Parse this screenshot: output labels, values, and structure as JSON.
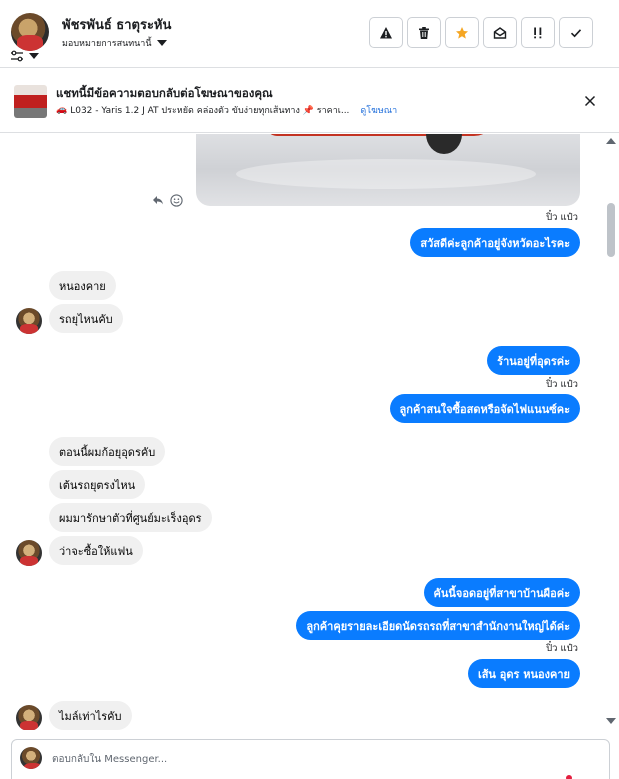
{
  "header": {
    "contact_name": "พัชรพันธ์ ธาตุระหัน",
    "assign_label": "มอบหมายการสนทนานี้",
    "actions": [
      {
        "name": "alert",
        "icon": "warning-icon"
      },
      {
        "name": "delete",
        "icon": "trash-icon"
      },
      {
        "name": "star",
        "icon": "star-icon"
      },
      {
        "name": "mark-unread",
        "icon": "envelope-open-icon"
      },
      {
        "name": "follow-up",
        "icon": "priority-icon"
      },
      {
        "name": "done",
        "icon": "check-icon"
      }
    ],
    "accent_star": "#f5a623"
  },
  "ad": {
    "title": "แชทนี้มีข้อความตอบกลับต่อโฆษณาของคุณ",
    "subtitle_prefix": "🚗",
    "subtitle": "L032 - Yaris 1.2 J AT ประหยัด คล่องตัว ขับง่ายทุกเส้นทาง 📌 ราคาเ...",
    "link": "ดูโฆษณา"
  },
  "messages": [
    {
      "id": "m1",
      "dir": "out",
      "text": "สวัสดีค่ะลูกค้าอยู่จังหวัดอะไรคะ",
      "seen": "ปิ๋ว แป๋ว"
    },
    {
      "id": "m2",
      "dir": "in",
      "text": "หนองคาย"
    },
    {
      "id": "m3",
      "dir": "in",
      "text": "รถยุไหนคับ"
    },
    {
      "id": "m4",
      "dir": "out",
      "text": "ร้านอยู่ที่อุดรค่ะ",
      "seen": "ปิ๋ว แป๋ว"
    },
    {
      "id": "m5",
      "dir": "out",
      "text": "ลูกค้าสนใจซื้อสดหรือจัดไฟแนนซ์คะ"
    },
    {
      "id": "m6",
      "dir": "in",
      "text": "ตอนนี้ผมก้อยุอุดรคับ"
    },
    {
      "id": "m7",
      "dir": "in",
      "text": "เต้นรถยุตรงไหน"
    },
    {
      "id": "m8",
      "dir": "in",
      "text": "ผมมารักษาตัวที่ศูนย์มะเร็งอุดร"
    },
    {
      "id": "m9",
      "dir": "in",
      "text": "ว่าจะซื้อให้แฟน"
    },
    {
      "id": "m10",
      "dir": "out",
      "text": "คันนี้จอดอยู่ที่สาขาบ้านผือค่ะ"
    },
    {
      "id": "m11",
      "dir": "out",
      "text": "ลูกค้าคุยรายละเอียดนัดรถรถที่สาขาสำนักงานใหญ่ได้ค่ะ",
      "seen": "ปิ๋ว แป๋ว"
    },
    {
      "id": "m12",
      "dir": "out",
      "text": "เส้น อุดร หนองคาย"
    },
    {
      "id": "m13",
      "dir": "in",
      "text": "ไมล์เท่าไรคับ"
    }
  ],
  "composer": {
    "placeholder": "ตอบกลับใน Messenger..."
  },
  "colors": {
    "outgoing_bubble": "#0a7cff",
    "incoming_bubble": "#f0f0f0",
    "link": "#216fdb"
  }
}
